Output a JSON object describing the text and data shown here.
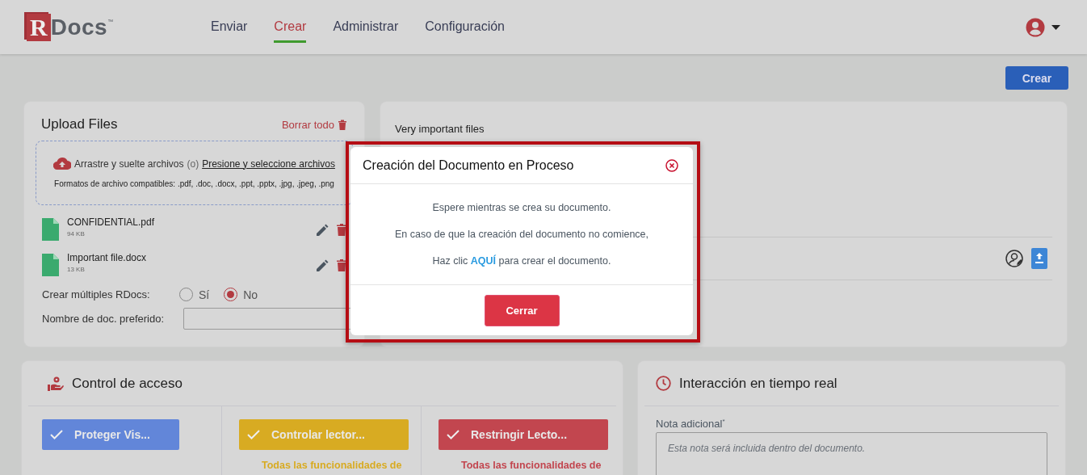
{
  "logo": {
    "mark": "R",
    "text": "Docs",
    "tm": "™"
  },
  "nav": [
    {
      "label": "Enviar",
      "selected": false
    },
    {
      "label": "Crear",
      "selected": true
    },
    {
      "label": "Administrar",
      "selected": false
    },
    {
      "label": "Configuración",
      "selected": false
    }
  ],
  "create_button": "Crear",
  "upload": {
    "title": "Upload Files",
    "clear_all": "Borrar todo",
    "dropzone": {
      "drag_text": "Arrastre y suelte archivos",
      "or": "(o)",
      "select_link": "Presione y seleccione archivos",
      "formats": "Formatos de archivo compatibles: .pdf, .doc, .docx, .ppt, .pptx, .jpg, .jpeg, .png"
    },
    "files": [
      {
        "name": "CONFIDENTIAL.pdf",
        "size": "94 KB"
      },
      {
        "name": "Important file.docx",
        "size": "13 KB"
      }
    ],
    "multiple": {
      "label": "Crear múltiples RDocs:",
      "options": [
        {
          "label": "Sí",
          "selected": false
        },
        {
          "label": "No",
          "selected": true
        }
      ]
    },
    "preferred_name": {
      "label": "Nombre de doc. preferido:"
    }
  },
  "document_panel": {
    "title": "Very important files"
  },
  "modal": {
    "title": "Creación del Documento en Proceso",
    "lines": [
      "Espere mientras se crea su documento.",
      "En caso de que la creación del documento no comience,"
    ],
    "link_line": {
      "before": "Haz clic",
      "link": "AQUÍ",
      "after": "para crear el documento."
    },
    "button": "Cerrar"
  },
  "access_control": {
    "title": "Control de acceso",
    "options": [
      {
        "label": "Proteger Vis...",
        "color": "#6286d9"
      },
      {
        "label": "Controlar lector...",
        "color": "#d8ab22",
        "description": "Todas las funcionalidades de"
      },
      {
        "label": "Restringir Lecto...",
        "color": "#c2464f",
        "description": "Todas las funcionalidades de"
      }
    ]
  },
  "interaction": {
    "title": "Interacción en tiempo real",
    "note_label": "Nota adicional",
    "required": "*",
    "placeholder": "Esta nota será incluida dentro del documento."
  }
}
